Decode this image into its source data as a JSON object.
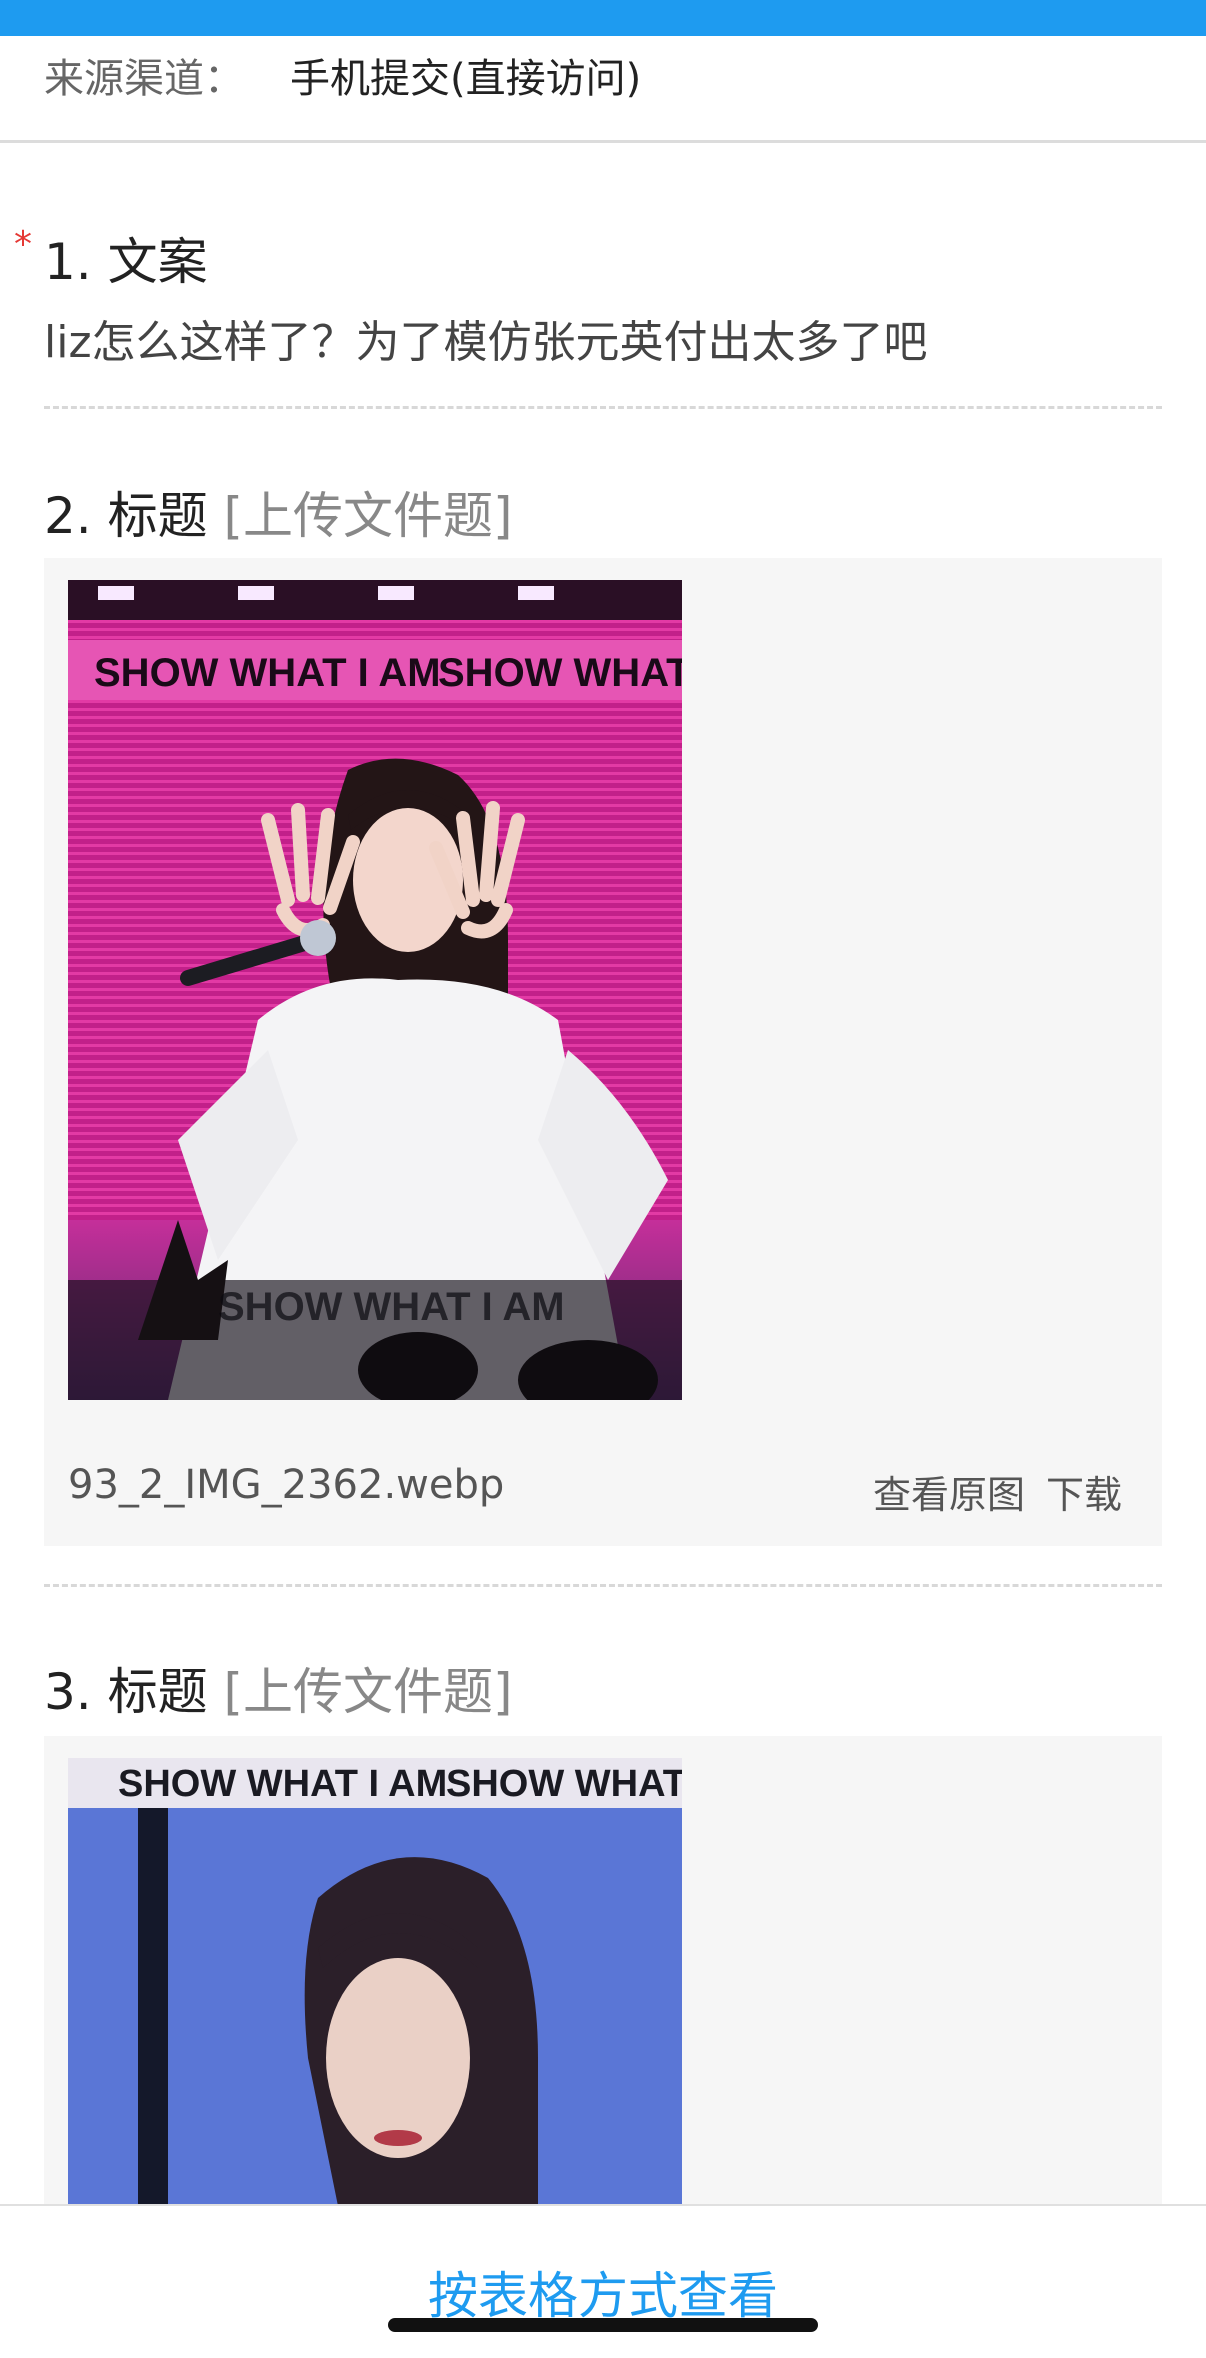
{
  "source": {
    "label": "来源渠道：",
    "value": "手机提交(直接访问)"
  },
  "questions": [
    {
      "title": "1. 文案",
      "required": true,
      "required_mark": "*",
      "answer": "liz怎么这样了？为了模仿张元英付出太多了吧"
    },
    {
      "title": "2. 标题",
      "type_label": "[上传文件题]",
      "file_name": "93_2_IMG_2362.webp",
      "view_label": "查看原图",
      "download_label": "下载",
      "image_banner": "SHOW WHAT I AM",
      "image_banner_2": "SHOW WHAT I",
      "image_bottom_text": "SHOW WHAT I AM"
    },
    {
      "title": "3. 标题",
      "type_label": "[上传文件题]",
      "image_banner": "SHOW WHAT I AM",
      "image_banner_2": "SHOW WHAT I"
    }
  ],
  "footer": {
    "table_view_label": "按表格方式查看"
  },
  "colors": {
    "accent": "#1e9bf0",
    "required": "#e53935",
    "panel_bg": "#f6f6f6"
  }
}
